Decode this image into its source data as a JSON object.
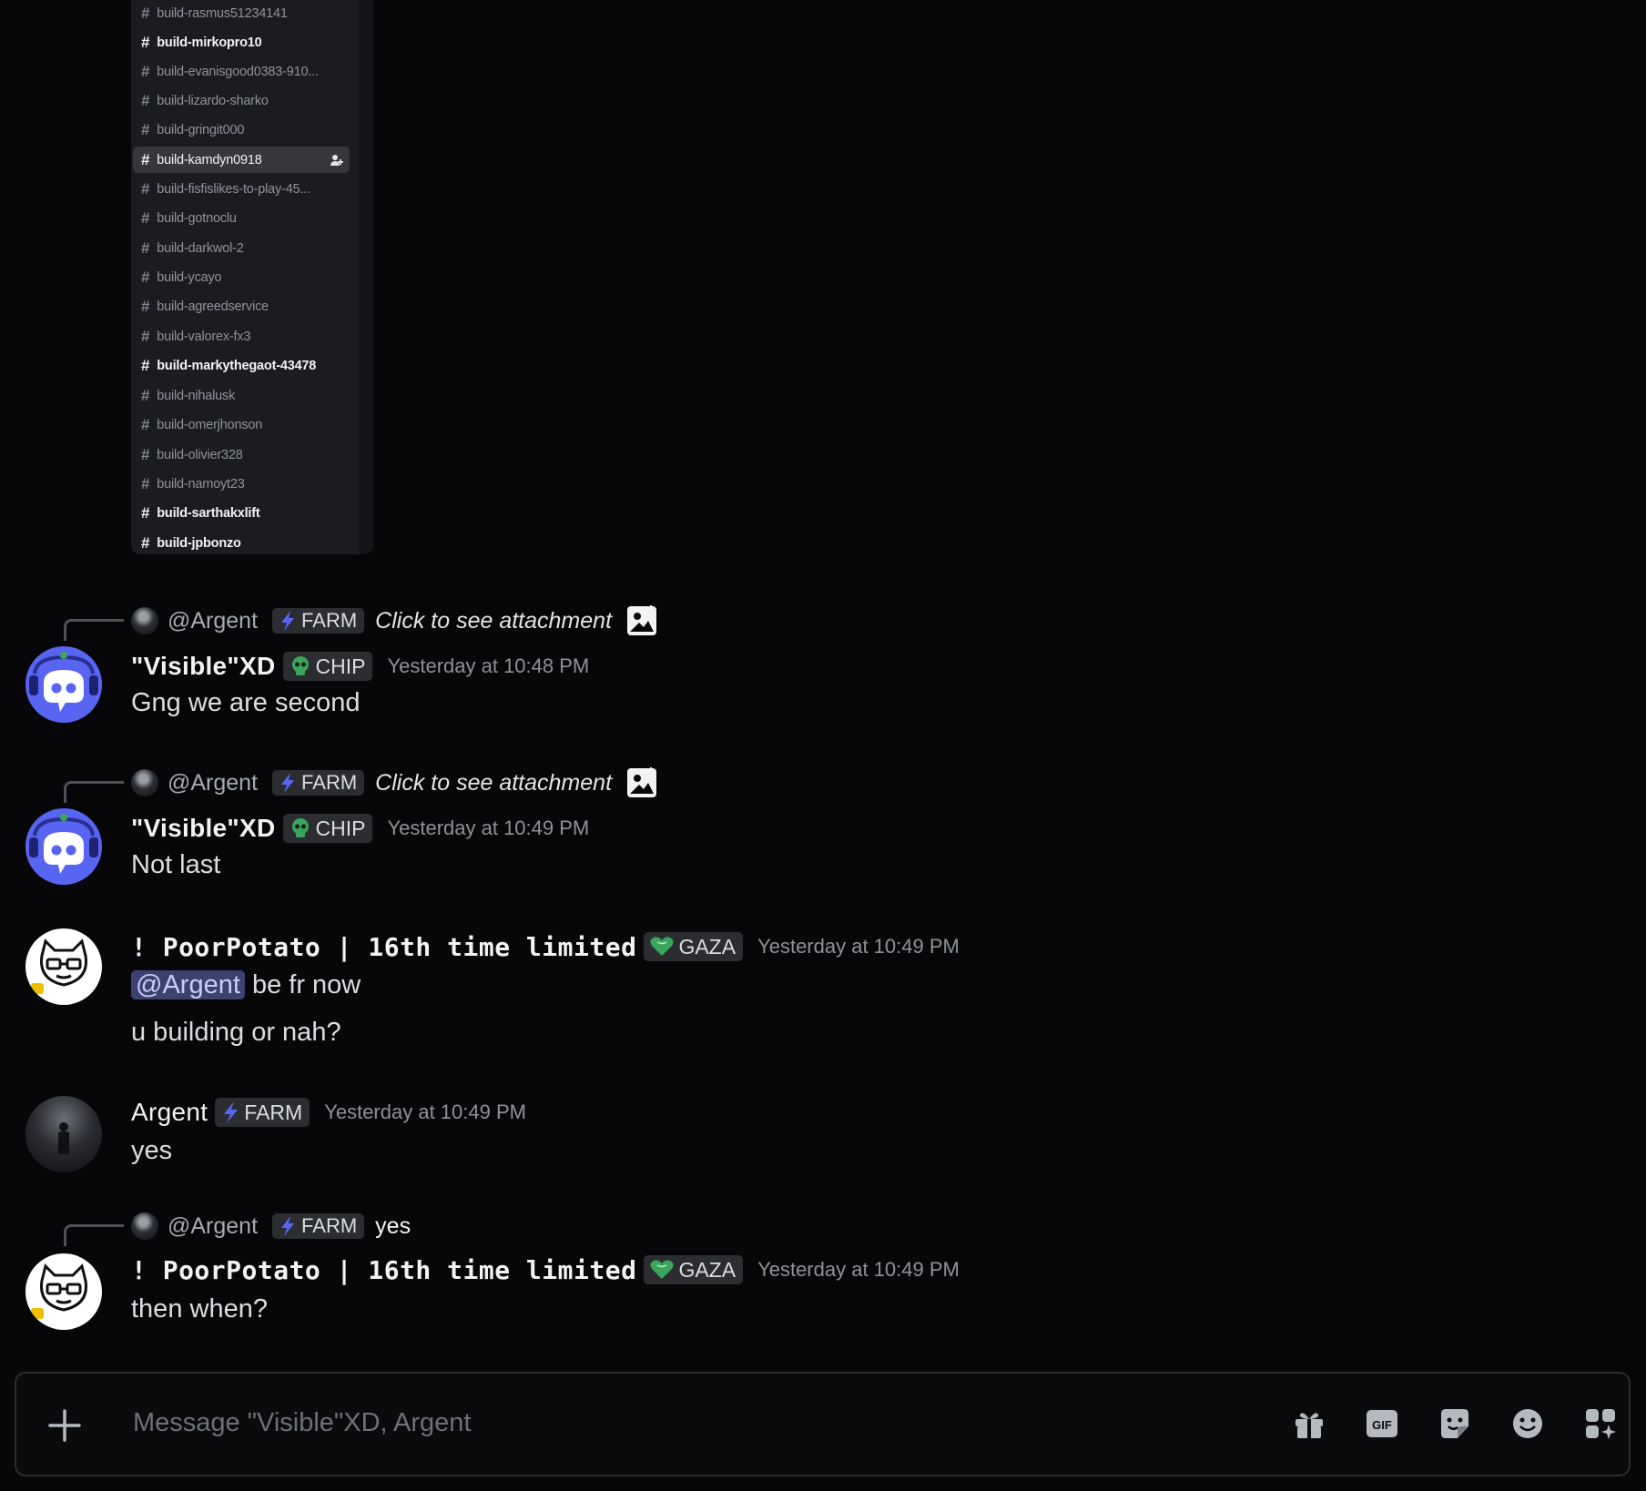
{
  "channels": [
    {
      "name": "build-rasmus51234141",
      "state": "normal"
    },
    {
      "name": "build-mirkopro10",
      "state": "unread"
    },
    {
      "name": "build-evanisgood0383-910...",
      "state": "normal"
    },
    {
      "name": "build-lizardo-sharko",
      "state": "normal"
    },
    {
      "name": "build-gringit000",
      "state": "normal"
    },
    {
      "name": "build-kamdyn0918",
      "state": "active"
    },
    {
      "name": "build-fisfislikes-to-play-45...",
      "state": "normal"
    },
    {
      "name": "build-gotnoclu",
      "state": "normal"
    },
    {
      "name": "build-darkwol-2",
      "state": "normal"
    },
    {
      "name": "build-ycayo",
      "state": "normal"
    },
    {
      "name": "build-agreedservice",
      "state": "normal"
    },
    {
      "name": "build-valorex-fx3",
      "state": "normal"
    },
    {
      "name": "build-markythegaot-43478",
      "state": "unread"
    },
    {
      "name": "build-nihalusk",
      "state": "normal"
    },
    {
      "name": "build-omerjhonson",
      "state": "normal"
    },
    {
      "name": "build-olivier328",
      "state": "normal"
    },
    {
      "name": "build-namoyt23",
      "state": "normal"
    },
    {
      "name": "build-sarthakxlift",
      "state": "unread"
    },
    {
      "name": "build-jpbonzo",
      "state": "unread"
    }
  ],
  "messages": [
    {
      "reply": {
        "name": "@Argent",
        "tag": "FARM",
        "text": "Click to see attachment"
      },
      "author": "\"Visible\"XD",
      "tag": "CHIP",
      "time": "Yesterday at 10:48 PM",
      "lines": [
        "Gng we are second"
      ]
    },
    {
      "reply": {
        "name": "@Argent",
        "tag": "FARM",
        "text": "Click to see attachment"
      },
      "author": "\"Visible\"XD",
      "tag": "CHIP",
      "time": "Yesterday at 10:49 PM",
      "lines": [
        "Not last"
      ]
    },
    {
      "author": "! PoorPotato | 16th time limited",
      "tag": "GAZA",
      "time": "Yesterday at 10:49 PM",
      "mention": "@Argent",
      "lines": [
        "be fr now",
        "u building or nah?"
      ]
    },
    {
      "author": "Argent",
      "tag": "FARM",
      "time": "Yesterday at 10:49 PM",
      "lines": [
        "yes"
      ]
    },
    {
      "reply": {
        "name": "@Argent",
        "tag": "FARM",
        "text": "yes"
      },
      "author": "! PoorPotato | 16th time limited",
      "tag": "GAZA",
      "time": "Yesterday at 10:49 PM",
      "lines": [
        "then when?"
      ]
    }
  ],
  "composer": {
    "placeholder": "Message \"Visible\"XD, Argent",
    "tools": [
      "gift-icon",
      "gif-icon",
      "sticker-icon",
      "emoji-icon",
      "apps-icon"
    ]
  },
  "colors": {
    "background": "#070709",
    "mention_bg": "#3c4270",
    "farm_bolt": "#5865f2",
    "tag_heart": "#3ba55c"
  }
}
